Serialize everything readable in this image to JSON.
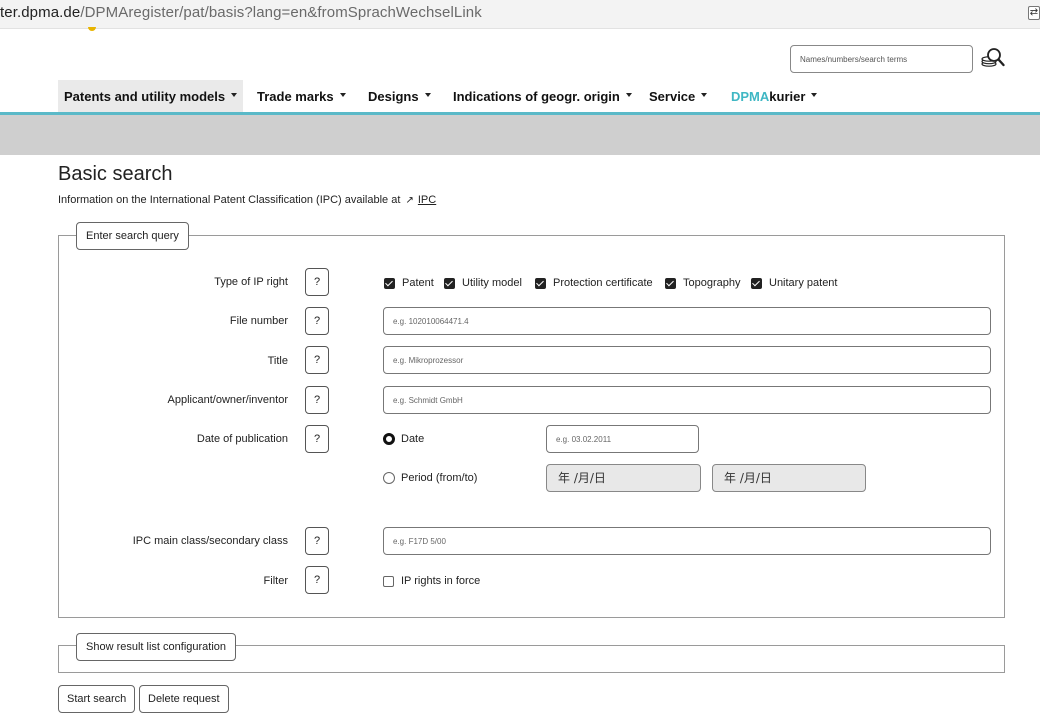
{
  "browser": {
    "url_host": "ter.dpma.de",
    "url_path": "/DPMAregister/pat/basis?lang=en&fromSprachWechselLink"
  },
  "header": {
    "search_placeholder": "Names/numbers/search terms",
    "search_icon": "magnifier-with-coins-icon"
  },
  "nav": {
    "items": [
      {
        "label": "Patents and utility models"
      },
      {
        "label": "Trade marks"
      },
      {
        "label": "Designs"
      },
      {
        "label": "Indications of geogr. origin"
      },
      {
        "label": "Service"
      },
      {
        "label_accent": "DPMA",
        "label_rest": "kurier"
      }
    ],
    "accent_color": "#3fb7c4"
  },
  "main": {
    "title": "Basic search",
    "info_text": "Information on the International Patent Classification (IPC) available at",
    "info_link": "IPC",
    "query_legend": "Enter search query",
    "help_label": "?",
    "rows": {
      "ip_type_label": "Type of IP right",
      "file_number_label": "File number",
      "title_label": "Title",
      "applicant_label": "Applicant/owner/inventor",
      "date_label": "Date of publication",
      "ipc_label": "IPC main class/secondary class",
      "filter_label": "Filter"
    },
    "ip_types": [
      "Patent",
      "Utility model",
      "Protection certificate",
      "Topography",
      "Unitary patent"
    ],
    "placeholders": {
      "file_number": "e.g. 102010064471.4",
      "title": "e.g. Mikroprozessor",
      "applicant": "e.g. Schmidt GmbH",
      "date": "e.g. 03.02.2011",
      "ipc": "e.g. F17D 5/00"
    },
    "date_option": "Date",
    "period_option": "Period (from/to)",
    "period_from": "年 /月/日",
    "period_to": "年 /月/日",
    "filter_option": "IP rights in force",
    "result_config_legend": "Show result list configuration",
    "start_search": "Start search",
    "delete_request": "Delete request"
  }
}
